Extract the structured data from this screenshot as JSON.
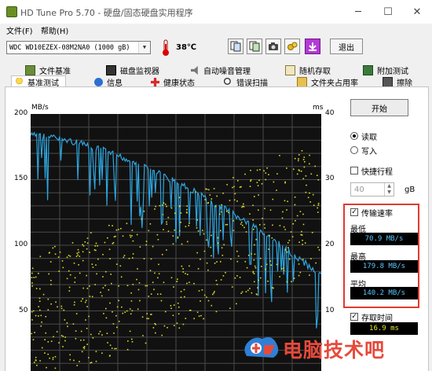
{
  "window": {
    "title": "HD Tune Pro 5.70 - 硬盘/固态硬盘实用程序",
    "minimize": "─",
    "maximize": "☐",
    "close": "✕"
  },
  "menu": [
    "文件(F)",
    "帮助(H)"
  ],
  "toolbar": {
    "drive": "WDC WD10EZEX-08M2NA0 (1000 gB)",
    "temperature": "38℃",
    "exit_label": "退出",
    "icons": [
      "copy-info-icon",
      "copy-results-icon",
      "screenshot-icon",
      "options-icon",
      "save-icon"
    ]
  },
  "tabs_top": [
    {
      "label": "文件基准",
      "icon": "file-benchmark-icon"
    },
    {
      "label": "磁盘监视器",
      "icon": "disk-monitor-icon"
    },
    {
      "label": "自动噪音管理",
      "icon": "noise-icon"
    },
    {
      "label": "随机存取",
      "icon": "random-access-icon"
    },
    {
      "label": "附加测试",
      "icon": "extra-tests-icon"
    }
  ],
  "tabs_bottom": [
    {
      "label": "基准测试",
      "icon": "benchmark-icon",
      "active": true
    },
    {
      "label": "信息",
      "icon": "info-icon"
    },
    {
      "label": "健康状态",
      "icon": "health-icon"
    },
    {
      "label": "错误扫描",
      "icon": "error-scan-icon"
    },
    {
      "label": "文件夹占用率",
      "icon": "folder-usage-icon"
    },
    {
      "label": "擦除",
      "icon": "erase-icon"
    }
  ],
  "graph": {
    "left_unit": "MB/s",
    "right_unit": "ms",
    "left_ticks": [
      "200",
      "150",
      "100",
      "50"
    ],
    "right_ticks": [
      "40",
      "30",
      "20",
      "10"
    ],
    "colors": {
      "background": "#111111",
      "grid": "#4a4a4a",
      "transfer": "#2ea6e0",
      "access": "#d9d92a"
    }
  },
  "controls": {
    "start_label": "开始",
    "read_label": "读取",
    "write_label": "写入",
    "read_selected": true,
    "quick_label": "快捷行程",
    "quick_checked": false,
    "quick_value": "40",
    "quick_unit": "gB",
    "transfer_label": "传输速率",
    "transfer_checked": true,
    "min_label": "最低",
    "min_value": "70.9 MB/s",
    "max_label": "最高",
    "max_value": "179.8 MB/s",
    "avg_label": "平均",
    "avg_value": "140.2 MB/s",
    "access_label": "存取时间",
    "access_checked": true,
    "access_value": "16.9 ms"
  },
  "watermark": {
    "text": "电脑技术吧"
  }
}
